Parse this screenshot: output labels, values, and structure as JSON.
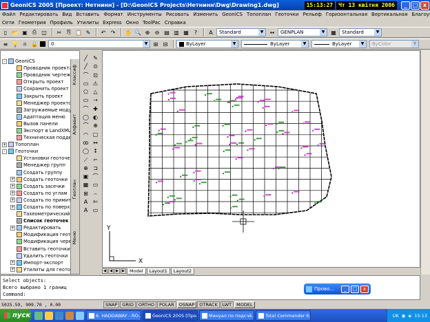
{
  "window": {
    "title": "GeoniCS 2005 [Проект: Нетнинн] - [D:\\GeoniCS Projects\\Нетнинн\\Dwg\\Drawing1.dwg]",
    "clock": "15:13:27",
    "date": "Чт 13 квітня 2006",
    "min": "_",
    "max": "□",
    "close": "x"
  },
  "menu1": [
    "Файл",
    "Редактировать",
    "Вид",
    "Вставить",
    "Формат",
    "Инструменты",
    "Рисовать",
    "Изменить",
    "GeoniCS",
    "Топоплан",
    "Геоточки",
    "Рельеф",
    "Горизонтальная",
    "Вертикальная",
    "Благоустройство"
  ],
  "menu2": [
    "Сети",
    "Геометрия",
    "Профиль",
    "Утилиты",
    "Express",
    "Окно",
    "ToolPac",
    "Справка"
  ],
  "toolbar1": {
    "style1": "Standard",
    "style2": "GENPLAN",
    "style3": "Standard"
  },
  "toolbar2": {
    "layer": "0",
    "color": "ByLayer",
    "linetype": "ByLayer",
    "lineweight": "ByLayer",
    "plotstyle": "ByColor"
  },
  "tree": [
    {
      "label": "GeoniCS",
      "level": 0,
      "pm": "-"
    },
    {
      "label": "Проводник проекта",
      "level": 1
    },
    {
      "label": "Проводник чертежа",
      "level": 1
    },
    {
      "label": "Открыть проект",
      "level": 1
    },
    {
      "label": "Сохранить проект",
      "level": 1
    },
    {
      "label": "Закрыть проект",
      "level": 1
    },
    {
      "label": "Менеджер проектов",
      "level": 1
    },
    {
      "label": "Загружаемые модули",
      "level": 1
    },
    {
      "label": "Адаптация меню",
      "level": 1
    },
    {
      "label": "Вызов панели",
      "level": 1
    },
    {
      "label": "Экспорт в LandXML",
      "level": 1
    },
    {
      "label": "Техническая поддержка",
      "level": 1
    },
    {
      "label": "Топоплан",
      "level": 0,
      "pm": "+"
    },
    {
      "label": "Геоточки",
      "level": 0,
      "pm": "-"
    },
    {
      "label": "Установки геоточек",
      "level": 1
    },
    {
      "label": "Менеджер групп",
      "level": 1
    },
    {
      "label": "Создать группу",
      "level": 1
    },
    {
      "label": "Создать геоточки",
      "level": 1,
      "pm": "+"
    },
    {
      "label": "Создать засечки",
      "level": 1,
      "pm": "+"
    },
    {
      "label": "Создать по углам",
      "level": 1,
      "pm": "+"
    },
    {
      "label": "Создать по примитивам",
      "level": 1,
      "pm": "+"
    },
    {
      "label": "Создать по поверхности",
      "level": 1,
      "pm": "+"
    },
    {
      "label": "Тахеометрический ход",
      "level": 1
    },
    {
      "label": "Список геоточек",
      "level": 1,
      "bold": true
    },
    {
      "label": "Редактировать",
      "level": 1,
      "pm": "+"
    },
    {
      "label": "Модификация геоточек",
      "level": 1
    },
    {
      "label": "Модификация через",
      "level": 1
    },
    {
      "label": "Вставить геоточки",
      "level": 1
    },
    {
      "label": "Удалить геоточки",
      "level": 1
    },
    {
      "label": "Импорт-экспорт",
      "level": 1,
      "pm": "+"
    },
    {
      "label": "Утилиты для геоточек",
      "level": 1,
      "pm": "+"
    }
  ],
  "vtabs": [
    "Классиф",
    "Алфавит",
    "Геоплан",
    "Меню"
  ],
  "drawtools": {
    "col1": [
      "╱",
      "╱",
      "⌒",
      "▭",
      "⬠",
      "▭",
      "⌒",
      "◯",
      "⌒",
      "◠",
      "ꝏ",
      "◯",
      "⟋",
      "⊕",
      "▣",
      "▦",
      "⊞",
      "A",
      "A"
    ],
    "col2": [
      "✎",
      "⊙",
      "⊡",
      "⚠",
      "△",
      "⇢",
      "✚",
      "◐",
      "⊕",
      "▢",
      "↔",
      "↕",
      "⌐",
      "⊐",
      "⌒",
      "▭",
      "⌢",
      "✄",
      "▭"
    ]
  },
  "layout_tabs": [
    "Model",
    "Layout1",
    "Layout2"
  ],
  "axis": {
    "y": "Y",
    "x": "X"
  },
  "command": {
    "line1": "Select objects:",
    "line2": "Всего выбрано 1 границ",
    "line3": "Command:"
  },
  "floatwin": {
    "title": "Прово..."
  },
  "status": {
    "coords": "5025.59, 909.70 , 0.00",
    "buttons": [
      "SNAP",
      "GRID",
      "ORTHO",
      "POLAR",
      "OSNAP",
      "OTRACK",
      "LWT",
      "MODEL"
    ]
  },
  "taskbar": {
    "start": "пуск",
    "tasks": [
      "6. HADDAWAY - RO...",
      "GeoniCS 2005 [Про...",
      "Мануал по подсчё...",
      "Total Commander 6...."
    ],
    "lang": "UK",
    "time": "15:13"
  },
  "colors": {
    "accent": "#0a5fd8",
    "point_green": "#1a8a1a",
    "point_magenta": "#c020c0",
    "grid": "#000000"
  }
}
